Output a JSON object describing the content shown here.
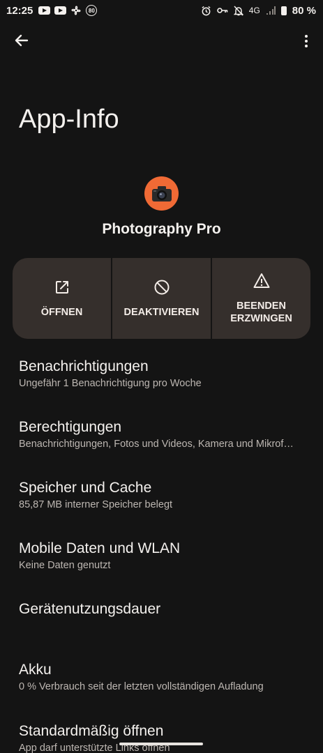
{
  "status": {
    "time": "12:25",
    "badge": "80",
    "network": "4G",
    "battery": "80 %"
  },
  "header": {
    "back_icon": "arrow-back-icon",
    "more_icon": "more-vert-icon",
    "title": "App-Info"
  },
  "app": {
    "name": "Photography Pro",
    "icon": "camera-icon",
    "icon_color": "#f06a35"
  },
  "actions": {
    "open": "ÖFFNEN",
    "disable": "DEAKTIVIEREN",
    "force_stop_line1": "BEENDEN",
    "force_stop_line2": "ERZWINGEN"
  },
  "settings": [
    {
      "title": "Benachrichtigungen",
      "sub": "Ungefähr 1 Benachrichtigung pro Woche"
    },
    {
      "title": "Berechtigungen",
      "sub": "Benachrichtigungen, Fotos und Videos, Kamera und Mikrof…"
    },
    {
      "title": "Speicher und Cache",
      "sub": "85,87 MB interner Speicher belegt"
    },
    {
      "title": "Mobile Daten und WLAN",
      "sub": "Keine Daten genutzt"
    },
    {
      "title": "Gerätenutzungsdauer",
      "sub": ""
    },
    {
      "title": "Akku",
      "sub": "0 % Verbrauch seit der letzten vollständigen Aufladung"
    },
    {
      "title": "Standardmäßig öffnen",
      "sub": "App darf unterstützte Links öffnen"
    }
  ]
}
